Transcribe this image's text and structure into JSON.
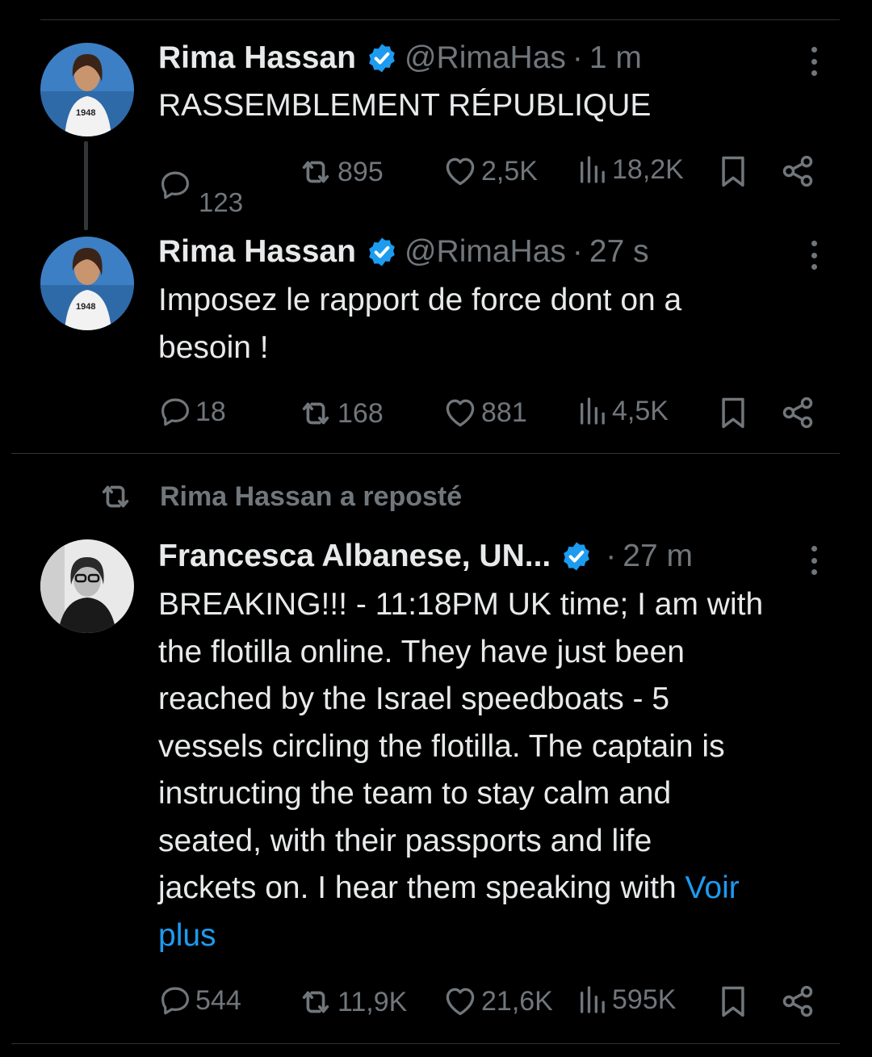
{
  "colors": {
    "background": "#000000",
    "text": "#e7e9ea",
    "muted": "#71767b",
    "accent": "#1d9bf0",
    "divider": "#2f3336"
  },
  "tweets": [
    {
      "name": "Rima Hassan",
      "handle": "@RimaHas",
      "dot": "·",
      "time": "1 m",
      "text": "RASSEMBLEMENT RÉPUBLIQUE",
      "avatar_text": "1948",
      "stats": {
        "replies": "123",
        "reposts": "895",
        "likes": "2,5K",
        "views": "18,2K"
      }
    },
    {
      "name": "Rima Hassan",
      "handle": "@RimaHas",
      "dot": "·",
      "time": "27 s",
      "text_lines": [
        "Imposez le rapport de force dont on a",
        "besoin !"
      ],
      "avatar_text": "1948",
      "stats": {
        "replies": "18",
        "reposts": "168",
        "likes": "881",
        "views": "4,5K"
      }
    },
    {
      "repost_label": "Rima Hassan a reposté",
      "name": "Francesca Albanese, UN...",
      "dot": "·",
      "time": "27 m",
      "text_lines": [
        "BREAKING!!! - 11:18PM UK time; I am with",
        "the flotilla online. They have just been",
        "reached by the Israel speedboats - 5",
        "vessels circling the flotilla. The captain is",
        "instructing the team to stay calm and",
        "seated, with their passports and life",
        "jackets on. I hear them speaking with "
      ],
      "more_link_1": "Voir",
      "more_link_2": "plus",
      "stats": {
        "replies": "544",
        "reposts": "11,9K",
        "likes": "21,6K",
        "views": "595K"
      }
    }
  ],
  "icons": [
    "more-icon",
    "verified-badge-icon",
    "reply-icon",
    "repost-icon",
    "like-icon",
    "views-icon",
    "bookmark-icon",
    "share-icon"
  ]
}
